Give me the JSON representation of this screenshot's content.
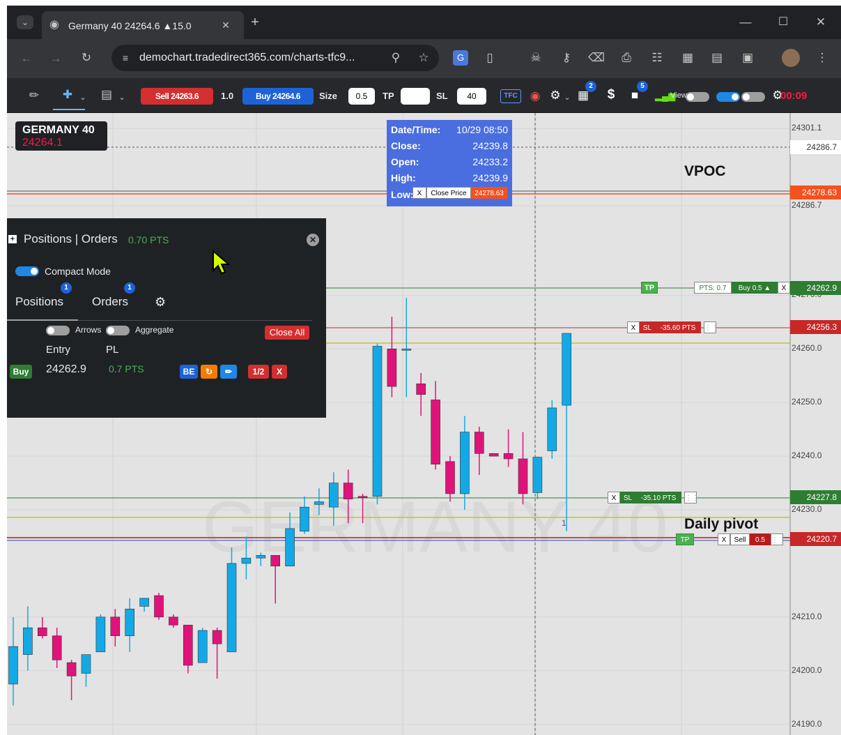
{
  "browser": {
    "tab_title": "Germany 40  24264.6  ▲15.0",
    "url": "demochart.tradedirect365.com/charts-tfc9..."
  },
  "toolbar": {
    "sell_label": "Sell 24263.6",
    "qty_value": "1.0",
    "buy_label": "Buy 24264.6",
    "size_label": "Size",
    "size_value": "0.5",
    "tp_label": "TP",
    "tp_value": "",
    "sl_label": "SL",
    "sl_value": "40",
    "tfc_label": "TFC",
    "badge_1": "2",
    "badge_2": "5",
    "dollar_label": "$",
    "view_label": "View",
    "timer": "00:09"
  },
  "symbol": {
    "name": "GERMANY 40",
    "price": "24264.1"
  },
  "ohlc": {
    "datetime_label": "Date/Time:",
    "datetime_value": "10/29 08:50",
    "close_label": "Close:",
    "close_value": "24239.8",
    "open_label": "Open:",
    "open_value": "24233.2",
    "high_label": "High:",
    "high_value": "24239.9",
    "low_label": "Low:"
  },
  "close_price_tag": {
    "x": "X",
    "label": "Close Price",
    "value": "24278.63"
  },
  "annotations": {
    "vpoc": "VPOC",
    "daily_pivot": "Daily pivot",
    "bar_marker": "1"
  },
  "order_tags": {
    "tp": "TP",
    "pts": "PTS: 0.7",
    "buy": "Buy 0.5 ▲",
    "close_x": "X",
    "sl1_x": "X",
    "sl1_label": "SL",
    "sl1_pts": "-35.60 PTS",
    "sl2_x": "X",
    "sl2_label": "SL",
    "sl2_pts": "-35.10 PTS",
    "tp2": "TP",
    "sell_x": "X",
    "sell_label": "Sell",
    "sell_qty": "0.5"
  },
  "price_axis": {
    "ticks": [
      "24301.1",
      "24286.7",
      "24270.0",
      "24260.0",
      "24250.0",
      "24240.0",
      "24230.0",
      "24210.0",
      "24200.0",
      "24190.0"
    ],
    "levels": {
      "level_286": "24286.7",
      "level_278": "24278.63",
      "level_262": "24262.9",
      "level_256": "24256.3",
      "level_227": "24227.8",
      "level_220": "24220.7"
    }
  },
  "panel": {
    "title": "Positions | Orders",
    "pts": "0.70 PTS",
    "compact_label": "Compact Mode",
    "tab_positions": "Positions",
    "tab_orders": "Orders",
    "badge_positions": "1",
    "badge_orders": "1",
    "arrows_label": "Arrows",
    "aggregate_label": "Aggregate",
    "close_all": "Close All",
    "entry_header": "Entry",
    "pl_header": "PL",
    "row_side": "Buy",
    "row_entry": "24262.9",
    "row_pl": "0.7 PTS",
    "btn_be": "BE",
    "btn_half": "1/2",
    "btn_x": "X"
  },
  "colors": {
    "up": "#13a9e6",
    "down": "#e0137a",
    "panel_bg": "#1f2225",
    "chart_bg": "#e3e3e3",
    "sell_red": "#d32f2f",
    "buy_blue": "#1e63d6",
    "green": "#2e7d32"
  },
  "chart_data": {
    "type": "candlestick",
    "symbol": "GERMANY 40",
    "ylim": [
      24188,
      24304
    ],
    "candles": [
      {
        "o": 24197.5,
        "h": 24210.0,
        "l": 24193.5,
        "c": 24204.5,
        "dir": "up"
      },
      {
        "o": 24203.0,
        "h": 24212.0,
        "l": 24200.0,
        "c": 24208.0,
        "dir": "up"
      },
      {
        "o": 24208.0,
        "h": 24210.0,
        "l": 24206.0,
        "c": 24206.5,
        "dir": "down"
      },
      {
        "o": 24206.5,
        "h": 24208.0,
        "l": 24200.5,
        "c": 24202.0,
        "dir": "down"
      },
      {
        "o": 24201.5,
        "h": 24202.0,
        "l": 24194.5,
        "c": 24199.0,
        "dir": "down"
      },
      {
        "o": 24199.5,
        "h": 24203.0,
        "l": 24197.0,
        "c": 24203.0,
        "dir": "up"
      },
      {
        "o": 24203.5,
        "h": 24210.5,
        "l": 24203.5,
        "c": 24210.0,
        "dir": "up"
      },
      {
        "o": 24210.0,
        "h": 24211.5,
        "l": 24204.5,
        "c": 24206.5,
        "dir": "down"
      },
      {
        "o": 24206.5,
        "h": 24213.5,
        "l": 24203.5,
        "c": 24211.5,
        "dir": "up"
      },
      {
        "o": 24212.0,
        "h": 24213.5,
        "l": 24211.0,
        "c": 24213.5,
        "dir": "up"
      },
      {
        "o": 24214.0,
        "h": 24214.5,
        "l": 24209.5,
        "c": 24210.0,
        "dir": "down"
      },
      {
        "o": 24210.0,
        "h": 24210.5,
        "l": 24208.0,
        "c": 24208.5,
        "dir": "down"
      },
      {
        "o": 24208.5,
        "h": 24208.5,
        "l": 24199.5,
        "c": 24201.0,
        "dir": "down"
      },
      {
        "o": 24201.5,
        "h": 24208.0,
        "l": 24201.5,
        "c": 24207.5,
        "dir": "up"
      },
      {
        "o": 24207.5,
        "h": 24208.0,
        "l": 24198.5,
        "c": 24205.0,
        "dir": "down"
      },
      {
        "o": 24203.5,
        "h": 24223.0,
        "l": 24203.5,
        "c": 24220.0,
        "dir": "up"
      },
      {
        "o": 24220.0,
        "h": 24225.0,
        "l": 24217.0,
        "c": 24221.0,
        "dir": "up"
      },
      {
        "o": 24221.0,
        "h": 24222.0,
        "l": 24219.5,
        "c": 24221.5,
        "dir": "up"
      },
      {
        "o": 24221.5,
        "h": 24221.5,
        "l": 24212.5,
        "c": 24219.5,
        "dir": "down"
      },
      {
        "o": 24219.5,
        "h": 24229.5,
        "l": 24219.5,
        "c": 24226.5,
        "dir": "up"
      },
      {
        "o": 24226.0,
        "h": 24232.5,
        "l": 24225.5,
        "c": 24230.5,
        "dir": "up"
      },
      {
        "o": 24231.0,
        "h": 24234.0,
        "l": 24229.0,
        "c": 24231.5,
        "dir": "up"
      },
      {
        "o": 24230.5,
        "h": 24237.0,
        "l": 24227.0,
        "c": 24235.0,
        "dir": "up"
      },
      {
        "o": 24235.0,
        "h": 24237.5,
        "l": 24227.5,
        "c": 24232.0,
        "dir": "down"
      },
      {
        "o": 24232.5,
        "h": 24233.0,
        "l": 24227.5,
        "c": 24232.5,
        "dir": "down"
      },
      {
        "o": 24232.5,
        "h": 24261.0,
        "l": 24231.0,
        "c": 24260.5,
        "dir": "up"
      },
      {
        "o": 24260.0,
        "h": 24266.0,
        "l": 24251.0,
        "c": 24253.0,
        "dir": "down"
      },
      {
        "o": 24260.0,
        "h": 24269.5,
        "l": 24251.0,
        "c": 24260.0,
        "dir": "up"
      },
      {
        "o": 24253.5,
        "h": 24255.5,
        "l": 24247.5,
        "c": 24251.5,
        "dir": "down"
      },
      {
        "o": 24250.5,
        "h": 24254.0,
        "l": 24237.5,
        "c": 24238.5,
        "dir": "down"
      },
      {
        "o": 24239.0,
        "h": 24240.0,
        "l": 24231.5,
        "c": 24233.0,
        "dir": "down"
      },
      {
        "o": 24233.0,
        "h": 24247.5,
        "l": 24230.0,
        "c": 24244.5,
        "dir": "up"
      },
      {
        "o": 24244.5,
        "h": 24245.5,
        "l": 24236.5,
        "c": 24240.5,
        "dir": "down"
      },
      {
        "o": 24240.5,
        "h": 24240.5,
        "l": 24240.0,
        "c": 24240.0,
        "dir": "down"
      },
      {
        "o": 24240.5,
        "h": 24245.0,
        "l": 24238.0,
        "c": 24239.5,
        "dir": "down"
      },
      {
        "o": 24239.5,
        "h": 24244.5,
        "l": 24231.0,
        "c": 24233.0,
        "dir": "down"
      },
      {
        "o": 24233.2,
        "h": 24239.9,
        "l": 24232.0,
        "c": 24239.8,
        "dir": "up"
      },
      {
        "o": 24241.0,
        "h": 24250.5,
        "l": 24239.5,
        "c": 24249.0,
        "dir": "up"
      },
      {
        "o": 24249.5,
        "h": 24262.9,
        "l": 24226.0,
        "c": 24262.9,
        "dir": "up"
      }
    ]
  }
}
